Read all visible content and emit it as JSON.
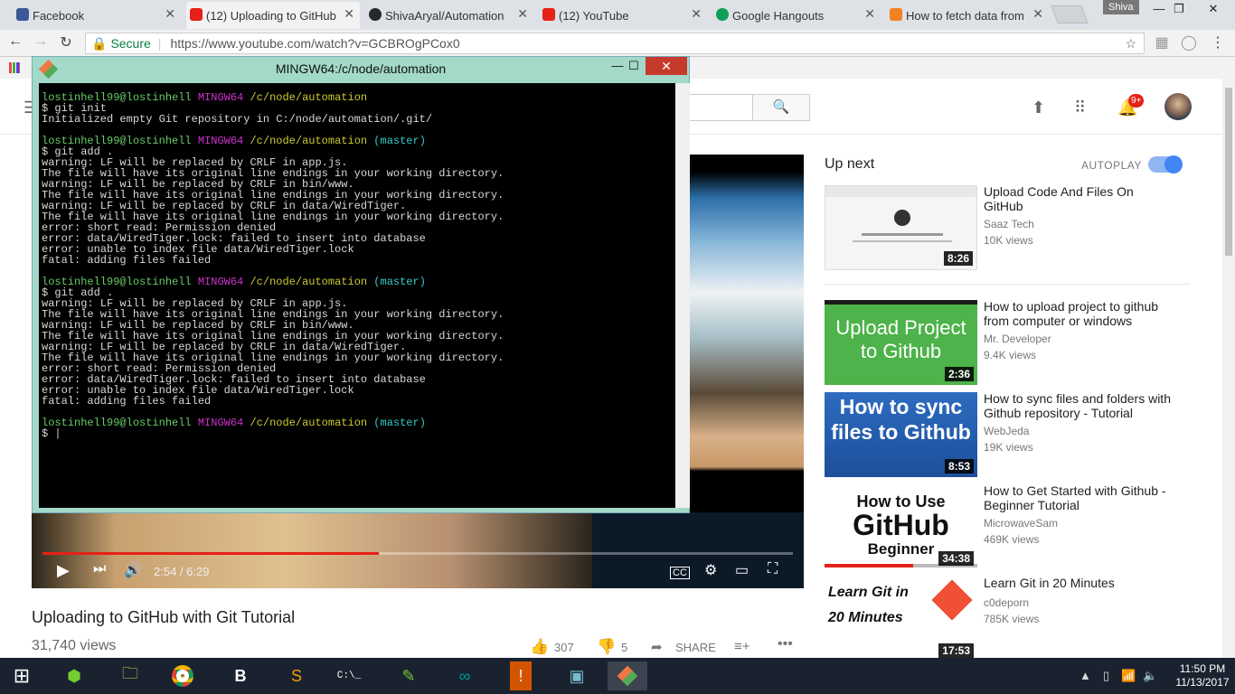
{
  "browser": {
    "tabs": [
      {
        "label": "Facebook",
        "color": "#3b5998"
      },
      {
        "label": "(12) Uploading to GitHub",
        "color": "#e62117",
        "active": true
      },
      {
        "label": "ShivaAryal/Automation",
        "color": "#24292e"
      },
      {
        "label": "(12) YouTube",
        "color": "#e62117"
      },
      {
        "label": "Google Hangouts",
        "color": "#0f9d58"
      },
      {
        "label": "How to fetch data from",
        "color": "#f48024"
      }
    ],
    "user_chip": "Shiva",
    "secure_label": "Secure",
    "url": "https://www.youtube.com/watch?v=GCBROgPCox0"
  },
  "terminal": {
    "title": "MINGW64:/c/node/automation",
    "prompt_user": "lostinhell99@lostinhell",
    "prompt_env": "MINGW64",
    "prompt_path": "/c/node/automation",
    "prompt_branch": "(master)",
    "cmd_init": "$ git init",
    "init_output": "Initialized empty Git repository in C:/node/automation/.git/",
    "cmd_add": "$ git add .",
    "add_output": [
      "warning: LF will be replaced by CRLF in app.js.",
      "The file will have its original line endings in your working directory.",
      "warning: LF will be replaced by CRLF in bin/www.",
      "The file will have its original line endings in your working directory.",
      "warning: LF will be replaced by CRLF in data/WiredTiger.",
      "The file will have its original line endings in your working directory.",
      "error: short read: Permission denied",
      "error: data/WiredTiger.lock: failed to insert into database",
      "error: unable to index file data/WiredTiger.lock",
      "fatal: adding files failed"
    ],
    "final_prompt": "$ |"
  },
  "player": {
    "time": "2:54 / 6:29",
    "progress_fraction": 0.448
  },
  "video": {
    "title": "Uploading to GitHub with Git Tutorial",
    "views": "31,740 views",
    "likes": "307",
    "dislikes": "5",
    "share": "SHARE"
  },
  "sidebar": {
    "upnext": "Up next",
    "autoplay": "AUTOPLAY",
    "videos": [
      {
        "title": "Upload Code And Files On GitHub",
        "channel": "Saaz Tech",
        "views": "10K views",
        "duration": "8:26"
      },
      {
        "title": "How to upload project to github from computer or windows",
        "channel": "Mr. Developer",
        "views": "9.4K views",
        "duration": "2:36",
        "thumb_text": "Upload Project to Github"
      },
      {
        "title": "How to sync files and folders with Github repository - Tutorial",
        "channel": "WebJeda",
        "views": "19K views",
        "duration": "8:53",
        "thumb_text": "How to sync files to Github"
      },
      {
        "title": "How to Get Started with Github - Beginner Tutorial",
        "channel": "MicrowaveSam",
        "views": "469K views",
        "duration": "34:38",
        "thumb_text_a": "How to Use",
        "thumb_text_b": "GitHub",
        "thumb_text_c": "Beginner"
      },
      {
        "title": "Learn Git in 20 Minutes",
        "channel": "c0deporn",
        "views": "785K views",
        "duration": "17:53",
        "thumb_text": "Learn Git in 20 Minutes"
      }
    ]
  },
  "header": {
    "notification_count": "9+"
  },
  "taskbar": {
    "time": "11:50 PM",
    "date": "11/13/2017"
  }
}
